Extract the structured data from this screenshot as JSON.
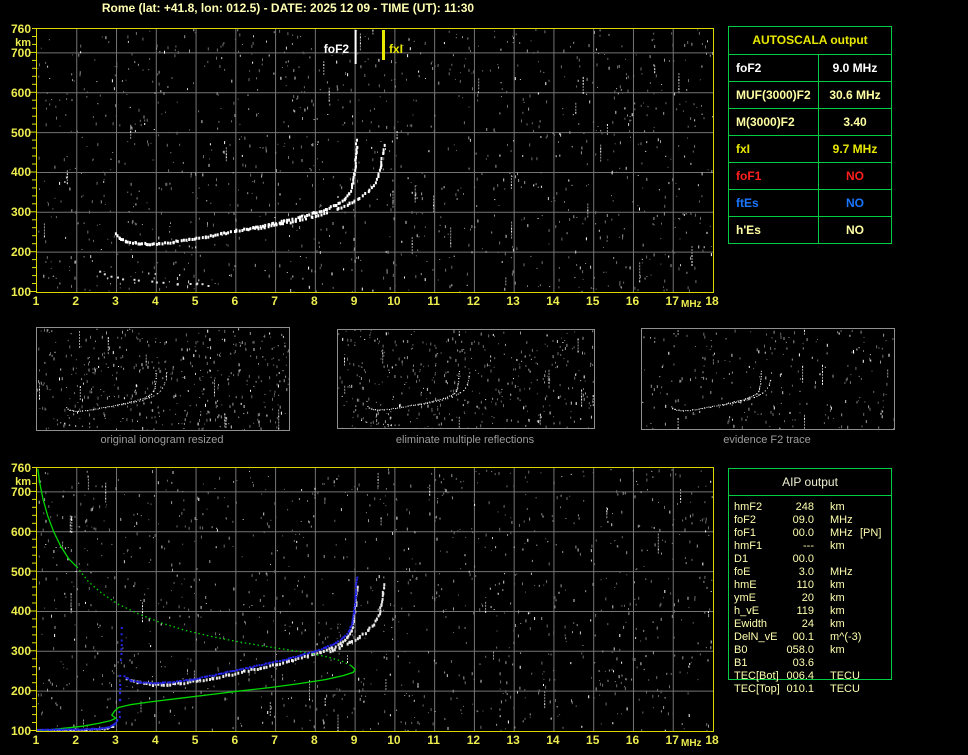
{
  "title": "Rome (lat: +41.8, lon: 012.5) - DATE: 2025 12 09 - TIME (UT): 11:30",
  "colors": {
    "background": "#000000",
    "title_text": "#ffffb3",
    "axis_border": "#d9d900",
    "axis_tick_label": "#ecec4e",
    "grid": "#747474",
    "noise_gray": "#8c8c8c",
    "trace_white": "#ffffff",
    "restored_trace_blue": "#2424e8",
    "profile_green": "#00d800",
    "table_border_green": "#00cc44",
    "pale_yellow": "#ffffa3",
    "bright_yellow": "#e9e900",
    "red": "#ff1f1f",
    "blue": "#1a75ff",
    "caption_gray": "#9c9c9c"
  },
  "axes": {
    "x_ticks": [
      "1",
      "2",
      "3",
      "4",
      "5",
      "6",
      "7",
      "8",
      "9",
      "10",
      "11",
      "12",
      "13",
      "14",
      "15",
      "16",
      "17",
      "18"
    ],
    "x_unit": "MHz",
    "y_ticks": [
      "760",
      "700",
      "600",
      "500",
      "400",
      "300",
      "200",
      "100"
    ],
    "y_tick_values": [
      760,
      700,
      600,
      500,
      400,
      300,
      200,
      100
    ],
    "y_unit": "km"
  },
  "autoscala": {
    "title": "AUTOSCALA output",
    "rows": [
      {
        "label": "foF2",
        "value": "9.0 MHz",
        "color": "white"
      },
      {
        "label": "MUF(3000)F2",
        "value": "30.6 MHz",
        "color": "pale"
      },
      {
        "label": "M(3000)F2",
        "value": "3.40",
        "color": "pale"
      },
      {
        "label": "fxI",
        "value": "9.7 MHz",
        "color": "yellow"
      },
      {
        "label": "foF1",
        "value": "NO",
        "color": "red"
      },
      {
        "label": "ftEs",
        "value": "NO",
        "color": "blue"
      },
      {
        "label": "h'Es",
        "value": "NO",
        "color": "pale"
      }
    ]
  },
  "aip": {
    "title": "AIP output",
    "rows": [
      {
        "label": "hmF2",
        "value": "248",
        "unit": "km",
        "note": ""
      },
      {
        "label": "foF2",
        "value": "09.0",
        "unit": "MHz",
        "note": ""
      },
      {
        "label": "foF1",
        "value": "00.0",
        "unit": "MHz",
        "note": "[PN]"
      },
      {
        "label": "hmF1",
        "value": "---",
        "unit": "km",
        "note": ""
      },
      {
        "label": "D1",
        "value": "00.0",
        "unit": "",
        "note": ""
      },
      {
        "label": "foE",
        "value": "3.0",
        "unit": "MHz",
        "note": ""
      },
      {
        "label": "hmE",
        "value": "110",
        "unit": "km",
        "note": ""
      },
      {
        "label": "ymE",
        "value": "20",
        "unit": "km",
        "note": ""
      },
      {
        "label": "h_vE",
        "value": "119",
        "unit": "km",
        "note": ""
      },
      {
        "label": "Ewidth",
        "value": "24",
        "unit": "km",
        "note": ""
      },
      {
        "label": "DelN_vE",
        "value": "00.1",
        "unit": "m^(-3)",
        "note": ""
      },
      {
        "label": "B0",
        "value": "058.0",
        "unit": "km",
        "note": ""
      },
      {
        "label": "B1",
        "value": "03.6",
        "unit": "",
        "note": ""
      },
      {
        "label": "TEC[Bot]",
        "value": "006.4",
        "unit": "TECU",
        "note": ""
      },
      {
        "label": "TEC[Top]",
        "value": "010.1",
        "unit": "TECU",
        "note": ""
      }
    ]
  },
  "thumbnails": [
    {
      "caption": "original ionogram resized"
    },
    {
      "caption": "eliminate multiple reflections"
    },
    {
      "caption": "evidence F2 trace"
    }
  ],
  "chart_data": [
    {
      "type": "scatter",
      "title": "scaled ionogram (top plot)",
      "xlabel": "MHz",
      "ylabel": "km",
      "xlim": [
        1,
        18
      ],
      "ylim": [
        100,
        760
      ],
      "grid": true,
      "markers": [
        {
          "label": "foF2",
          "x": 9.0,
          "color": "#ffffff"
        },
        {
          "label": "fxI",
          "x": 9.7,
          "color": "#e9e900"
        }
      ],
      "series": [
        {
          "name": "O-trace",
          "color": "#ffffff",
          "points": [
            [
              2.95,
              248
            ],
            [
              3.05,
              238
            ],
            [
              3.2,
              231
            ],
            [
              3.45,
              226
            ],
            [
              3.75,
              223
            ],
            [
              4.05,
              225
            ],
            [
              4.4,
              229
            ],
            [
              4.8,
              235
            ],
            [
              5.2,
              242
            ],
            [
              5.6,
              249
            ],
            [
              6,
              257
            ],
            [
              6.4,
              264
            ],
            [
              6.8,
              272
            ],
            [
              7.2,
              281
            ],
            [
              7.6,
              291
            ],
            [
              7.95,
              301
            ],
            [
              8.25,
              311
            ],
            [
              8.5,
              322
            ],
            [
              8.7,
              335
            ],
            [
              8.83,
              351
            ],
            [
              8.91,
              372
            ],
            [
              8.96,
              400
            ],
            [
              8.99,
              435
            ],
            [
              9.01,
              468
            ],
            [
              9.02,
              483
            ]
          ]
        },
        {
          "name": "X-trace",
          "color": "#ffffff",
          "points": [
            [
              6.3,
              259
            ],
            [
              6.7,
              266
            ],
            [
              7.1,
              274
            ],
            [
              7.5,
              282
            ],
            [
              7.9,
              292
            ],
            [
              8.25,
              302
            ],
            [
              8.55,
              313
            ],
            [
              8.85,
              326
            ],
            [
              9.1,
              340
            ],
            [
              9.3,
              355
            ],
            [
              9.45,
              372
            ],
            [
              9.56,
              394
            ],
            [
              9.63,
              422
            ],
            [
              9.68,
              452
            ],
            [
              9.7,
              472
            ]
          ]
        },
        {
          "name": "trace-fragment",
          "color": "#e0e0e0",
          "points": [
            [
              2.55,
              152
            ],
            [
              2.85,
              143
            ],
            [
              3.15,
              136
            ],
            [
              3.55,
              130
            ],
            [
              4,
              126
            ],
            [
              4.5,
              123
            ],
            [
              5,
              121
            ],
            [
              5.3,
              120
            ]
          ]
        }
      ]
    },
    {
      "type": "scatter",
      "title": "AIP profile (bottom plot)",
      "xlabel": "MHz",
      "ylabel": "km",
      "xlim": [
        1,
        18
      ],
      "ylim": [
        100,
        760
      ],
      "grid": true,
      "series": [
        {
          "name": "ionogram-trace-E",
          "color": "#e8e8e8",
          "points": [
            [
              1,
              103
            ],
            [
              1.6,
              103
            ],
            [
              2.1,
              104
            ],
            [
              2.5,
              106
            ],
            [
              2.75,
              108
            ],
            [
              2.9,
              114
            ]
          ]
        },
        {
          "name": "ionogram-trace-F",
          "color": "#e8e8e8",
          "points": [
            [
              3.25,
              233
            ],
            [
              3.5,
              226
            ],
            [
              3.9,
              220
            ],
            [
              4.25,
              220
            ],
            [
              4.6,
              223
            ],
            [
              5,
              229
            ],
            [
              5.4,
              236
            ],
            [
              5.8,
              244
            ],
            [
              6.2,
              253
            ],
            [
              6.6,
              262
            ],
            [
              7,
              271
            ],
            [
              7.4,
              281
            ],
            [
              7.8,
              291
            ],
            [
              8.1,
              301
            ],
            [
              8.4,
              312
            ],
            [
              8.62,
              324
            ],
            [
              8.78,
              338
            ],
            [
              8.88,
              355
            ],
            [
              8.94,
              380
            ],
            [
              8.99,
              420
            ],
            [
              9.03,
              465
            ]
          ]
        },
        {
          "name": "ionogram-trace-X",
          "color": "#e8e8e8",
          "points": [
            [
              8.35,
              302
            ],
            [
              8.6,
              313
            ],
            [
              8.85,
              326
            ],
            [
              9.1,
              340
            ],
            [
              9.3,
              355
            ],
            [
              9.45,
              371
            ],
            [
              9.57,
              392
            ],
            [
              9.64,
              420
            ],
            [
              9.69,
              450
            ],
            [
              9.72,
              470
            ]
          ]
        },
        {
          "name": "restored-trace-E",
          "color": "#2424e8",
          "points": [
            [
              1,
              106
            ],
            [
              1.5,
              106
            ],
            [
              2,
              106
            ],
            [
              2.35,
              107
            ],
            [
              2.6,
              109
            ],
            [
              2.8,
              112
            ],
            [
              2.92,
              119
            ],
            [
              3,
              130
            ]
          ]
        },
        {
          "name": "restored-trace-cusp",
          "color": "#2424e8",
          "points": [
            [
              3.05,
              138
            ],
            [
              3.05,
              150
            ],
            [
              3.06,
              164
            ],
            [
              3.06,
              180
            ],
            [
              3.07,
              198
            ],
            [
              3.07,
              218
            ],
            [
              3.08,
              240
            ],
            [
              3.08,
              265
            ],
            [
              3.09,
              295
            ],
            [
              3.1,
              330
            ],
            [
              3.1,
              360
            ]
          ]
        },
        {
          "name": "restored-trace-F",
          "color": "#2424e8",
          "points": [
            [
              3.18,
              239
            ],
            [
              3.32,
              230
            ],
            [
              3.55,
              225
            ],
            [
              3.85,
              222
            ],
            [
              4.15,
              223
            ],
            [
              4.5,
              226
            ],
            [
              4.85,
              231
            ],
            [
              5.2,
              238
            ],
            [
              5.6,
              246
            ],
            [
              6,
              255
            ],
            [
              6.4,
              263
            ],
            [
              6.8,
              272
            ],
            [
              7.2,
              281
            ],
            [
              7.6,
              292
            ],
            [
              7.95,
              302
            ],
            [
              8.25,
              312
            ],
            [
              8.5,
              324
            ],
            [
              8.7,
              337
            ],
            [
              8.82,
              352
            ],
            [
              8.9,
              372
            ],
            [
              8.95,
              400
            ],
            [
              8.99,
              440
            ],
            [
              9.02,
              487
            ]
          ]
        },
        {
          "name": "density-profile-topside",
          "color": "#00d800",
          "style": "line",
          "points": [
            [
              1.02,
              758
            ],
            [
              1.07,
              722
            ],
            [
              1.15,
              682
            ],
            [
              1.27,
              640
            ],
            [
              1.42,
              600
            ],
            [
              1.6,
              563
            ],
            [
              1.8,
              532
            ],
            [
              2,
              512
            ]
          ]
        },
        {
          "name": "density-profile-topside-dotted",
          "color": "#00d800",
          "style": "dotted-line",
          "points": [
            [
              2,
              512
            ],
            [
              2.3,
              474
            ],
            [
              2.65,
              444
            ],
            [
              3.05,
              418
            ],
            [
              3.55,
              394
            ],
            [
              4.1,
              372
            ],
            [
              4.75,
              352
            ],
            [
              5.4,
              337
            ],
            [
              6.05,
              324
            ],
            [
              6.7,
              313
            ],
            [
              7.3,
              304
            ],
            [
              7.85,
              295
            ],
            [
              8.3,
              286
            ],
            [
              8.65,
              276
            ],
            [
              8.9,
              264
            ]
          ]
        },
        {
          "name": "density-profile-bottomside",
          "color": "#00d800",
          "style": "line",
          "points": [
            [
              8.9,
              264
            ],
            [
              9,
              254
            ],
            [
              8.95,
              247
            ],
            [
              8.7,
              239
            ],
            [
              8.25,
              229
            ],
            [
              7.6,
              219
            ],
            [
              6.85,
              209
            ],
            [
              6.05,
              200
            ],
            [
              5.25,
              190
            ],
            [
              4.5,
              181
            ],
            [
              3.85,
              173
            ],
            [
              3.35,
              166
            ],
            [
              3.05,
              159
            ],
            [
              2.95,
              150
            ],
            [
              2.88,
              140
            ],
            [
              2.98,
              132
            ],
            [
              2.85,
              126
            ],
            [
              2.55,
              119
            ],
            [
              2.15,
              112
            ],
            [
              1.7,
              107
            ],
            [
              1.3,
              103
            ],
            [
              1.05,
              100
            ]
          ]
        }
      ]
    }
  ]
}
